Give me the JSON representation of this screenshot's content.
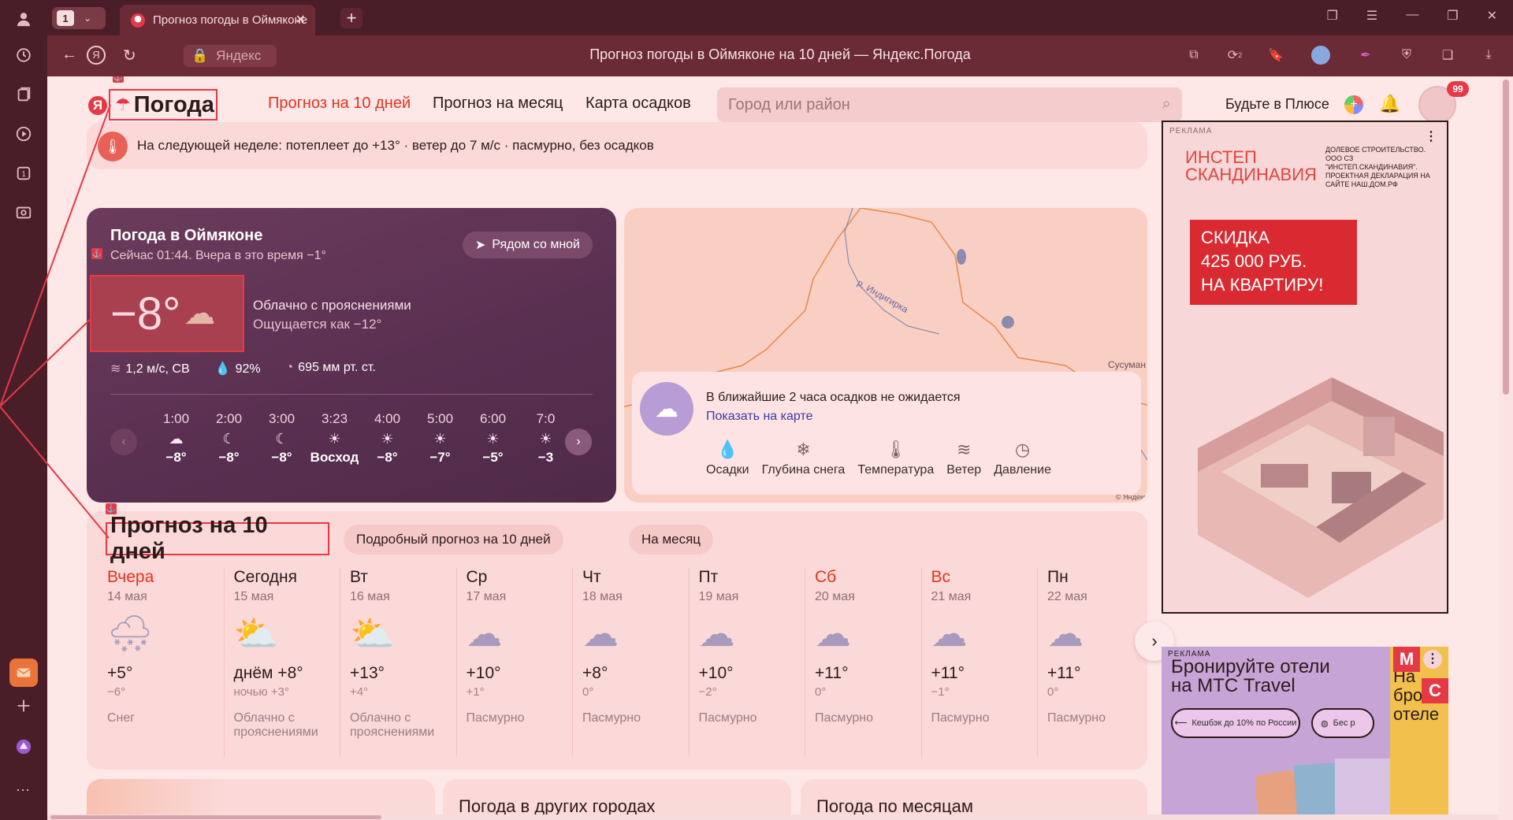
{
  "browser": {
    "tab_count": "1",
    "tab_title": "Прогноз погоды в Оймяконе",
    "yandex_label": "Яндекс",
    "page_title": "Прогноз погоды в Оймяконе на 10 дней — Яндекс.Погода",
    "ext_badge": "2"
  },
  "header": {
    "logo_ya": "Я",
    "logo_text": "Погода",
    "nav": [
      "Прогноз на 10 дней",
      "Прогноз на месяц",
      "Карта осадков"
    ],
    "search_placeholder": "Город или район",
    "plus_text": "Будьте в Плюсе",
    "notif_count": "99"
  },
  "alert": {
    "text": "На следующей неделе: потеплеет до +13° · ветер до 7 м/с · пасмурно, без осадков"
  },
  "now": {
    "city": "Погода в Оймяконе",
    "subtitle": "Сейчас 01:44. Вчера в это время −1°",
    "near_button": "Рядом со мной",
    "temperature": "−8°",
    "condition": "Облачно с прояснениями",
    "feels_like": "Ощущается как −12°",
    "wind": "1,2 м/с, СВ",
    "humidity": "92%",
    "pressure": "695 мм рт. ст.",
    "hourly": [
      {
        "time": "1:00",
        "icon": "☁",
        "temp": "−8°"
      },
      {
        "time": "2:00",
        "icon": "☾",
        "temp": "−8°"
      },
      {
        "time": "3:00",
        "icon": "☾",
        "temp": "−8°"
      },
      {
        "time": "3:23",
        "icon": "☀",
        "temp": "Восход"
      },
      {
        "time": "4:00",
        "icon": "☀",
        "temp": "−8°"
      },
      {
        "time": "5:00",
        "icon": "☀",
        "temp": "−7°"
      },
      {
        "time": "6:00",
        "icon": "☀",
        "temp": "−5°"
      },
      {
        "time": "7:0",
        "icon": "☀",
        "temp": "−3"
      }
    ]
  },
  "map": {
    "river_label": "р. Индигирка",
    "town_label": "Сусуман",
    "copyright": "© Яндекс",
    "precip_text": "В ближайшие 2 часа осадков не ожидается",
    "precip_link": "Показать на карте",
    "layers": [
      {
        "label": "Осадки",
        "icon": "💧"
      },
      {
        "label": "Глубина снега",
        "icon": "❄"
      },
      {
        "label": "Температура",
        "icon": "🌡"
      },
      {
        "label": "Ветер",
        "icon": "≋"
      },
      {
        "label": "Давление",
        "icon": "◷"
      }
    ]
  },
  "forecast": {
    "title": "Прогноз на 10 дней",
    "pill_detailed": "Подробный прогноз на 10 дней",
    "pill_month": "На месяц",
    "days": [
      {
        "name": "Вчера",
        "date": "14 мая",
        "icon": "🌨",
        "temp": "+5°",
        "night": "−6°",
        "cond": "Снег",
        "red": true
      },
      {
        "name": "Сегодня",
        "date": "15 мая",
        "icon": "⛅",
        "temp": "днём +8°",
        "night": "ночью +3°",
        "cond": "Облачно с прояснениями",
        "red": false
      },
      {
        "name": "Вт",
        "date": "16 мая",
        "icon": "⛅",
        "temp": "+13°",
        "night": "+4°",
        "cond": "Облачно с прояснениями",
        "red": false
      },
      {
        "name": "Ср",
        "date": "17 мая",
        "icon": "☁",
        "temp": "+10°",
        "night": "+1°",
        "cond": "Пасмурно",
        "red": false
      },
      {
        "name": "Чт",
        "date": "18 мая",
        "icon": "☁",
        "temp": "+8°",
        "night": "0°",
        "cond": "Пасмурно",
        "red": false
      },
      {
        "name": "Пт",
        "date": "19 мая",
        "icon": "☁",
        "temp": "+10°",
        "night": "−2°",
        "cond": "Пасмурно",
        "red": false
      },
      {
        "name": "Сб",
        "date": "20 мая",
        "icon": "☁",
        "temp": "+11°",
        "night": "0°",
        "cond": "Пасмурно",
        "red": true
      },
      {
        "name": "Вс",
        "date": "21 мая",
        "icon": "☁",
        "temp": "+11°",
        "night": "−1°",
        "cond": "Пасмурно",
        "red": true
      },
      {
        "name": "Пн",
        "date": "22 мая",
        "icon": "☁",
        "temp": "+11°",
        "night": "0°",
        "cond": "Пасмурно",
        "red": false
      }
    ]
  },
  "bottom": {
    "other_cities": "Погода в других городах",
    "by_months": "Погода по месяцам"
  },
  "ads": {
    "tag": "РЕКЛАМА",
    "ad1_brand_1": "ИНСТЕП",
    "ad1_brand_2": "СКАНДИНАВИЯ",
    "ad1_fine": "ДОЛЕВОЕ СТРОИТЕЛЬСТВО. ООО СЗ \"ИНСТЕП.СКАНДИНАВИЯ\". ПРОЕКТНАЯ ДЕКЛАРАЦИЯ НА САЙТЕ НАШ.ДОМ.РФ",
    "ad1_offer_1": "СКИДКА",
    "ad1_offer_2": "425 000 РУБ.",
    "ad1_offer_3": "НА КВАРТИРУ!",
    "ad2_text_1": "Бронируйте отели",
    "ad2_text_2": "на МТС Travel",
    "ad2_btn": "Кешбэк до 10% по России",
    "ad2_btn2": "Бес р",
    "ad2_side_1": "На",
    "ad2_side_2": "брон",
    "ad2_side_3": "отеле",
    "ad2_mark_m": "М",
    "ad2_mark_c": "С"
  },
  "colors": {
    "accent": "#e63946",
    "nav_active": "#e1331f",
    "card_bg": "#fbd9d8",
    "now_card": "#5a3051"
  }
}
